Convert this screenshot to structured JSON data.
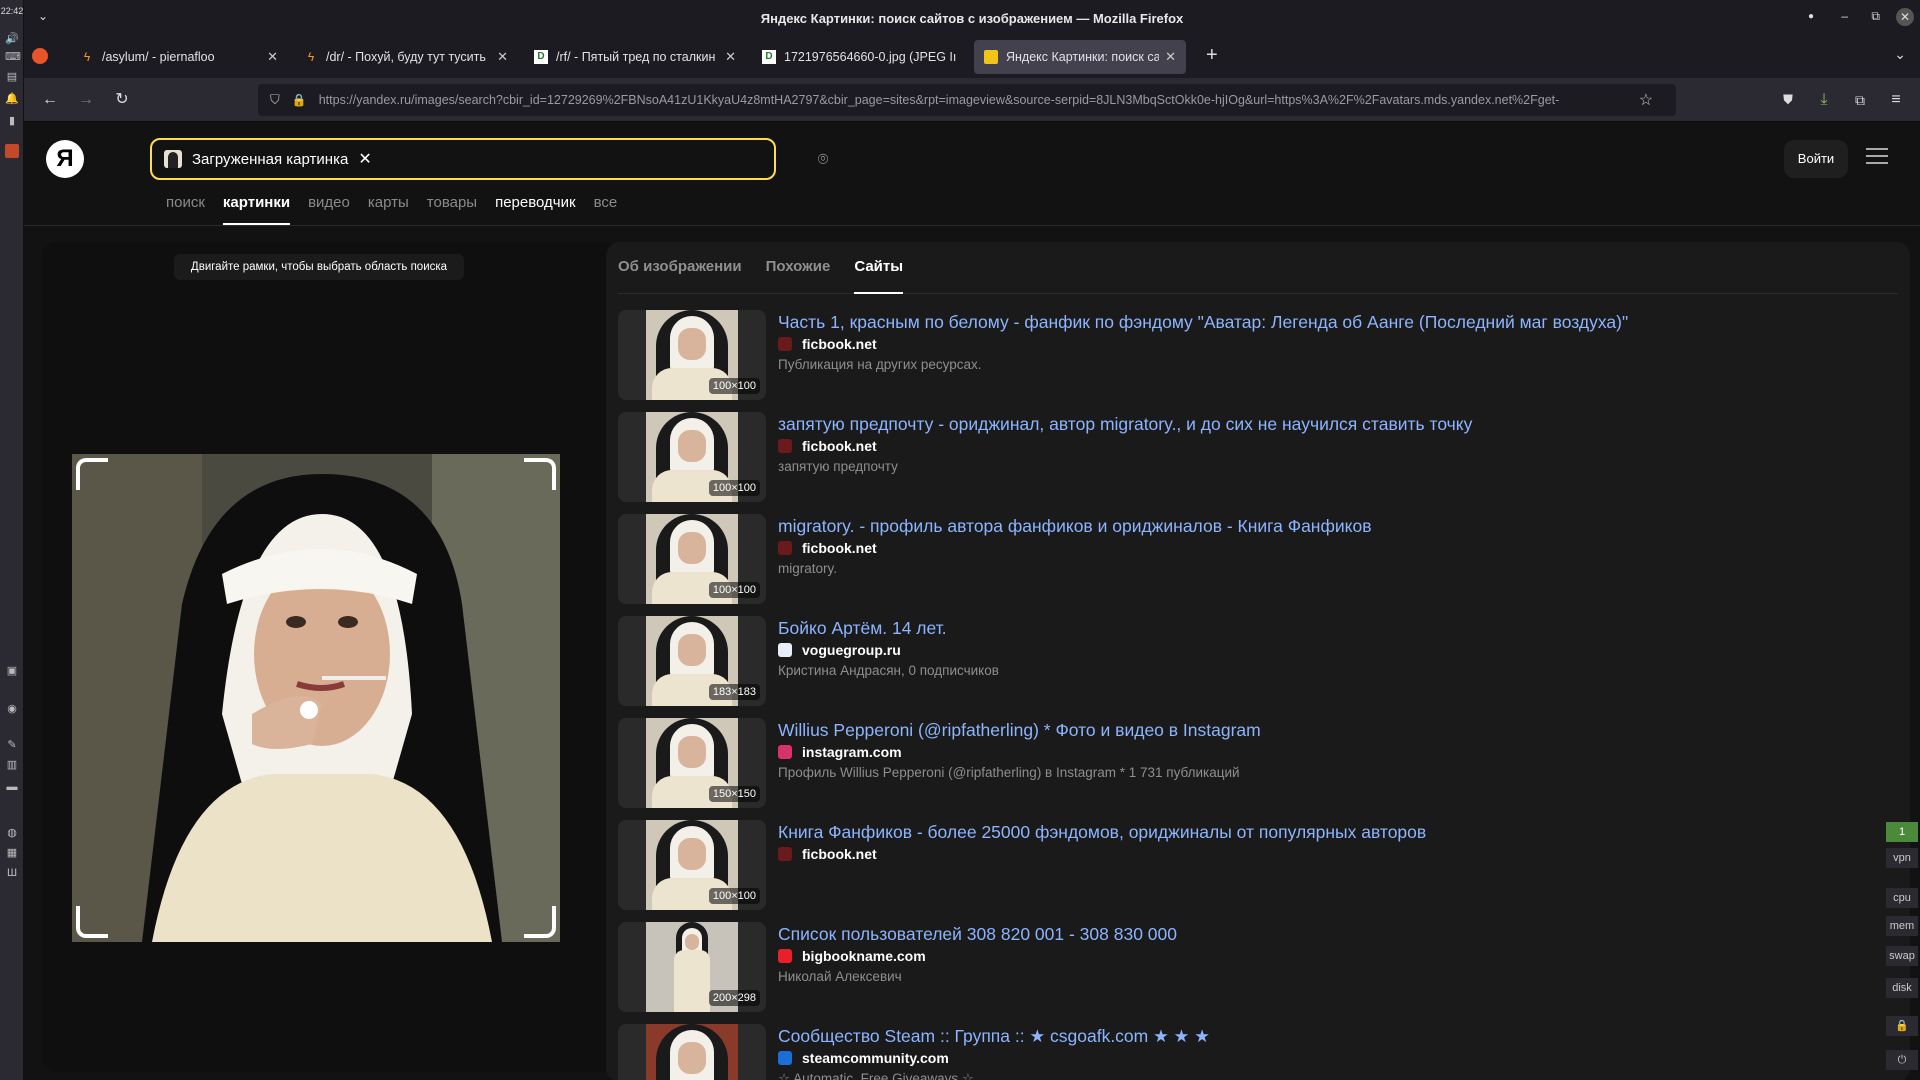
{
  "system": {
    "clock": "22:42",
    "meters": [
      "1",
      "vpn",
      "cpu",
      "mem",
      "swap",
      "disk"
    ]
  },
  "window": {
    "title": "Яндекс Картинки: поиск сайтов с изображением — Mozilla Firefox"
  },
  "tabs": [
    {
      "label": "/asylum/ - piernafloo",
      "icon": "bolt-icon"
    },
    {
      "label": "/dr/ - Похуй, буду тут тусить",
      "icon": "bolt-icon"
    },
    {
      "label": "/rf/ - Пятый тред по сталкин",
      "icon": "page-icon"
    },
    {
      "label": "1721976564660-0.jpg (JPEG Iı",
      "icon": "page-icon"
    },
    {
      "label": "Яндекс Картинки: поиск сай",
      "icon": "yandex-images-icon"
    }
  ],
  "navbar": {
    "url": "https://yandex.ru/images/search?cbir_id=12729269%2FBNsoA41zU1KkyaU4z8mtHA2797&cbir_page=sites&rpt=imageview&source-serpid=8JLN3MbqSctOkk0e-hjIOg&url=https%3A%2F%2Favatars.mds.yandex.net%2Fget-"
  },
  "header": {
    "logo": "Я",
    "chip_label": "Загруженная картинка",
    "login_label": "Войти",
    "services": [
      {
        "label": "поиск",
        "state": "normal"
      },
      {
        "label": "картинки",
        "state": "active"
      },
      {
        "label": "видео",
        "state": "normal"
      },
      {
        "label": "карты",
        "state": "normal"
      },
      {
        "label": "товары",
        "state": "normal"
      },
      {
        "label": "переводчик",
        "state": "bright"
      },
      {
        "label": "все",
        "state": "normal"
      }
    ]
  },
  "crop": {
    "hint": "Двигайте рамки, чтобы выбрать область поиска"
  },
  "results_tabs": [
    {
      "label": "Об изображении",
      "active": false
    },
    {
      "label": "Похожие",
      "active": false
    },
    {
      "label": "Сайты",
      "active": true
    }
  ],
  "results": [
    {
      "title": "Часть 1, красным по белому - фанфик по фэндому \"Аватар: Легенда об Аанге (Последний маг воздуха)\"",
      "site": "ficbook.net",
      "favicon_color": "#6a1a1a",
      "desc": "Публикация на других ресурсах.",
      "size": "100×100",
      "variant": "nun"
    },
    {
      "title": "запятую предпочту - ориджинал, автор migratory., и до сих не научился ставить точку",
      "site": "ficbook.net",
      "favicon_color": "#6a1a1a",
      "desc": "запятую предпочту",
      "size": "100×100",
      "variant": "nun"
    },
    {
      "title": "migratory. - профиль автора фанфиков и ориджиналов - Книга Фанфиков",
      "site": "ficbook.net",
      "favicon_color": "#6a1a1a",
      "desc": "migratory.",
      "size": "100×100",
      "variant": "nun"
    },
    {
      "title": "Бойко Артём. 14 лет.",
      "site": "voguegroup.ru",
      "favicon_color": "#e8eef8",
      "desc": "Кристина Андрасян, 0 подписчиков",
      "size": "183×183",
      "variant": "nun"
    },
    {
      "title": "Willius Pepperoni (@ripfatherling) * Фото и видео в Instagram",
      "site": "instagram.com",
      "favicon_color": "#d6336c",
      "desc": "Профиль Willius Pepperoni (@ripfatherling) в Instagram * 1 731 публикаций",
      "size": "150×150",
      "variant": "nun"
    },
    {
      "title": "Книга Фанфиков - более 25000 фэндомов, ориджиналы от популярных авторов",
      "site": "ficbook.net",
      "favicon_color": "#6a1a1a",
      "desc": "",
      "size": "100×100",
      "variant": "nun"
    },
    {
      "title": "Список пользователей 308 820 001 - 308 830 000",
      "site": "bigbookname.com",
      "favicon_color": "#e8202a",
      "desc": "Николай Алексевич",
      "size": "200×298",
      "variant": "tall"
    },
    {
      "title": "Сообщество Steam :: Группа :: ★ csgoafk.com ★ ★ ★",
      "site": "steamcommunity.com",
      "favicon_color": "#1a6ed8",
      "desc": "☆ Automatic, Free Giveaways ☆",
      "size": "",
      "variant": "red"
    }
  ]
}
